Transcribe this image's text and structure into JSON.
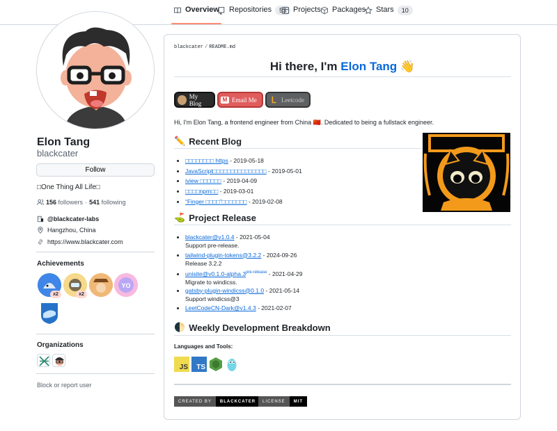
{
  "nav": {
    "tabs": [
      {
        "label": "Overview",
        "icon": "book-icon",
        "active": true
      },
      {
        "label": "Repositories",
        "icon": "repo-icon",
        "count": "53"
      },
      {
        "label": "Projects",
        "icon": "table-icon"
      },
      {
        "label": "Packages",
        "icon": "package-icon"
      },
      {
        "label": "Stars",
        "icon": "star-icon",
        "count": "10"
      }
    ]
  },
  "profile": {
    "full_name": "Elon Tang",
    "username": "blackcater",
    "follow_label": "Follow",
    "bio": "□One Thing All Life□",
    "followers_count": "156",
    "followers_label": "followers",
    "dot": "·",
    "following_count": "541",
    "following_label": "following",
    "org": "@blackcater-labs",
    "location": "Hangzhou, China",
    "website": "https://www.blackcater.com",
    "achievements_title": "Achievements",
    "badge_counts": [
      "x2",
      "x2"
    ],
    "organizations_title": "Organizations",
    "block_label": "Block or report user"
  },
  "readme": {
    "breadcrumb_user": "blackcater",
    "breadcrumb_sep": "/",
    "breadcrumb_file": "README.md",
    "title_prefix": "Hi there, I'm ",
    "title_name": "Elon Tang",
    "title_emoji": "👋",
    "pills": {
      "blog": "My Blog",
      "email": "Email Me",
      "leetcode": "Leetcode"
    },
    "intro": "Hi, I'm Elon Tang, a frontend engineer from China 🇨🇳. Dedicated to being a fullstack engineer.",
    "blog_heading": "Recent Blog",
    "blog_emoji": "✏️",
    "blog_items": [
      {
        "title": "□□□□□□□□ https",
        "date": " - 2019-05-18"
      },
      {
        "title": "JavaScript□□□□□□□□□□□□□□□",
        "date": " - 2019-05-01"
      },
      {
        "title": "iview □□□□□□",
        "date": " - 2019-04-09"
      },
      {
        "title": "□□□□npm□□",
        "date": " - 2019-03-01"
      },
      {
        "title": "“Finger □□□□”□□□□□□□",
        "date": " - 2019-02-08"
      }
    ],
    "release_heading": "Project Release",
    "release_emoji": "⛳",
    "releases": [
      {
        "name": "blackcater@v1.0.4",
        "sup": "",
        "date": " - 2021-05-04",
        "desc": "Support pre-release."
      },
      {
        "name": "tailwind-plugin-tokens@3.2.2",
        "sup": "",
        "date": " - 2024-09-26",
        "desc": "Release 3.2.2"
      },
      {
        "name": "unisite@v0.1.0-alpha.3",
        "sup": "pre-release",
        "date": " - 2021-04-29",
        "desc": "Migrate to windicss."
      },
      {
        "name": "gatsby-plugin-windicss@0.1.0",
        "sup": "",
        "date": " - 2021-05-14",
        "desc": "Support windicss@3"
      },
      {
        "name": "LeetCodeCN-Dark@v1.4.3",
        "sup": "",
        "date": " - 2021-02-07",
        "desc": ""
      }
    ],
    "weekly_heading": "Weekly Development Breakdown",
    "weekly_emoji": "🌓",
    "languages_title": "Languages and Tools:",
    "lang_icons": {
      "js": "JS",
      "ts": "TS"
    },
    "shield1": {
      "label": "CREATED BY",
      "value": "BLACKCATER"
    },
    "shield2": {
      "label": "LICENSE",
      "value": "MIT"
    }
  },
  "colors": {
    "accent": "#0969da",
    "tab_underline": "#fd8c73",
    "email_pill": "#e05d5d",
    "leetcode_pill": "#5f6062"
  }
}
